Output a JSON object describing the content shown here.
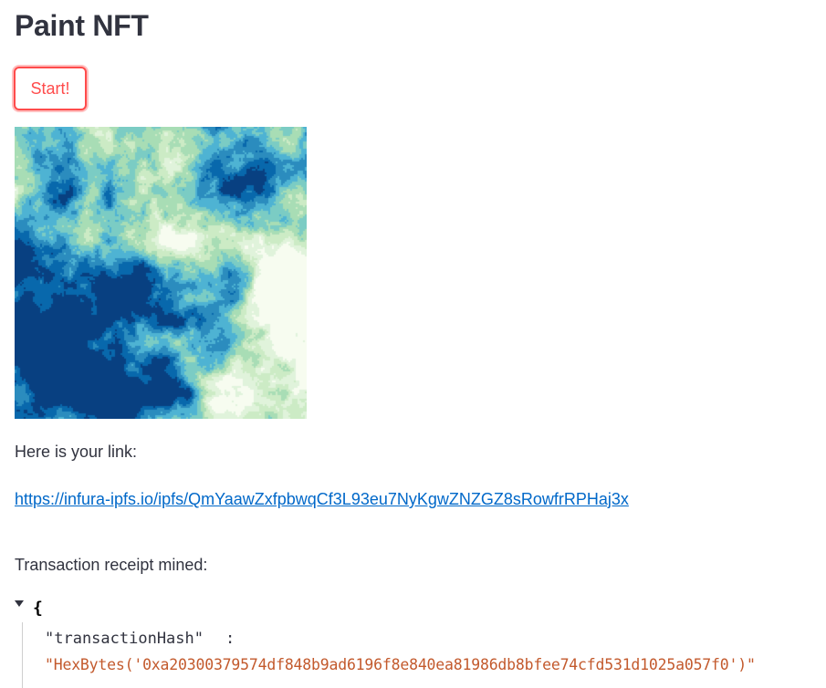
{
  "page": {
    "title": "Paint NFT"
  },
  "actions": {
    "start_label": "Start!"
  },
  "nft_image": {
    "description": "generated abstract painting",
    "palette": [
      "#f7fcf0",
      "#e0f3db",
      "#ccebc5",
      "#a8ddb5",
      "#7bccc4",
      "#4eb3d3",
      "#2b8cbe",
      "#0868ac",
      "#084081"
    ]
  },
  "result": {
    "link_label": "Here is your link:",
    "link_url": "https://infura-ipfs.io/ipfs/QmYaawZxfpbwqCf3L93eu7NyKgwZNZGZ8sRowfrRPHaj3x",
    "receipt_label": "Transaction receipt mined:"
  },
  "receipt_json": {
    "open_brace": "{",
    "key": "\"transactionHash\"",
    "colon": ":",
    "value": "\"HexBytes('0xa20300379574df848b9ad6196f8e840ea81986db8bfee74cfd531d1025a057f0')\""
  },
  "theme": {
    "primary": "#ff4b4b",
    "text": "#31333f",
    "link": "#0068c9",
    "json_string": "#c35a2d"
  }
}
